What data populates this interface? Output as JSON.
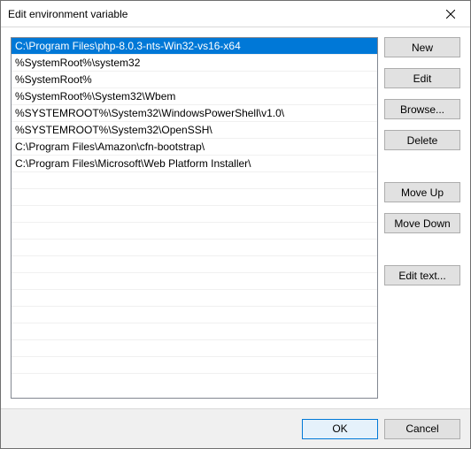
{
  "titlebar": {
    "title": "Edit environment variable"
  },
  "list": {
    "items": [
      "C:\\Program Files\\php-8.0.3-nts-Win32-vs16-x64",
      "%SystemRoot%\\system32",
      "%SystemRoot%",
      "%SystemRoot%\\System32\\Wbem",
      "%SYSTEMROOT%\\System32\\WindowsPowerShell\\v1.0\\",
      "%SYSTEMROOT%\\System32\\OpenSSH\\",
      "C:\\Program Files\\Amazon\\cfn-bootstrap\\",
      "C:\\Program Files\\Microsoft\\Web Platform Installer\\"
    ],
    "selected_index": 0
  },
  "buttons": {
    "new": "New",
    "edit": "Edit",
    "browse": "Browse...",
    "delete": "Delete",
    "move_up": "Move Up",
    "move_down": "Move Down",
    "edit_text": "Edit text...",
    "ok": "OK",
    "cancel": "Cancel"
  }
}
